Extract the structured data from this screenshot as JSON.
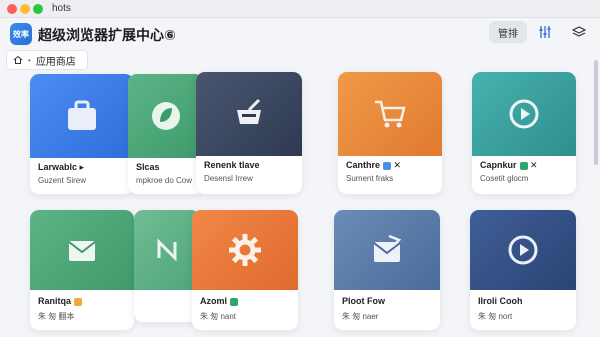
{
  "window": {
    "title": "hots"
  },
  "header": {
    "logo_text": "效率",
    "app_name": "超级浏览器扩展中心⑥",
    "manage_label": "管排"
  },
  "breadcrumb": {
    "label": "应用商店"
  },
  "cards": [
    {
      "name": "Larwablc",
      "name_suffix": "▸",
      "sub": "Guzent Sirew",
      "color": "#3d7de8"
    },
    {
      "name": "Slcas",
      "name_suffix": "",
      "sub": "mpkroe do Cow",
      "color": "#4aa775"
    },
    {
      "name": "Renenk",
      "name_suffix": "tlave",
      "sub": "Desensl Irrew",
      "color": "#3b4660"
    },
    {
      "name": "Canthre",
      "name_suffix": "✕",
      "sub": "Sument fraks",
      "color": "#e8873a"
    },
    {
      "name": "Capnkur",
      "name_suffix": "✕",
      "sub": "Cosetit glocm",
      "color": "#3aa6a4"
    },
    {
      "name": "Ranitqa",
      "name_suffix": "",
      "sub": "朱 匆 翻本",
      "color": "#4fa77b"
    },
    {
      "name": "",
      "name_suffix": "",
      "sub": "",
      "color": "#62b48a"
    },
    {
      "name": "Azoml",
      "name_suffix": "",
      "sub": "朱 匆 nant",
      "color": "#e9733a"
    },
    {
      "name": "Ploot",
      "name_suffix": "Fow",
      "sub": "朱 匆 naer",
      "color": "#5a7ba8"
    },
    {
      "name": "Ilroli Cooh",
      "name_suffix": "",
      "sub": "朱 匆 nort",
      "color": "#334e83"
    }
  ],
  "icons": {
    "manage": "manage-icon",
    "sliders": "sliders-icon",
    "layers": "layers-icon",
    "home": "home-icon",
    "chevron": "chevron-down-icon"
  }
}
